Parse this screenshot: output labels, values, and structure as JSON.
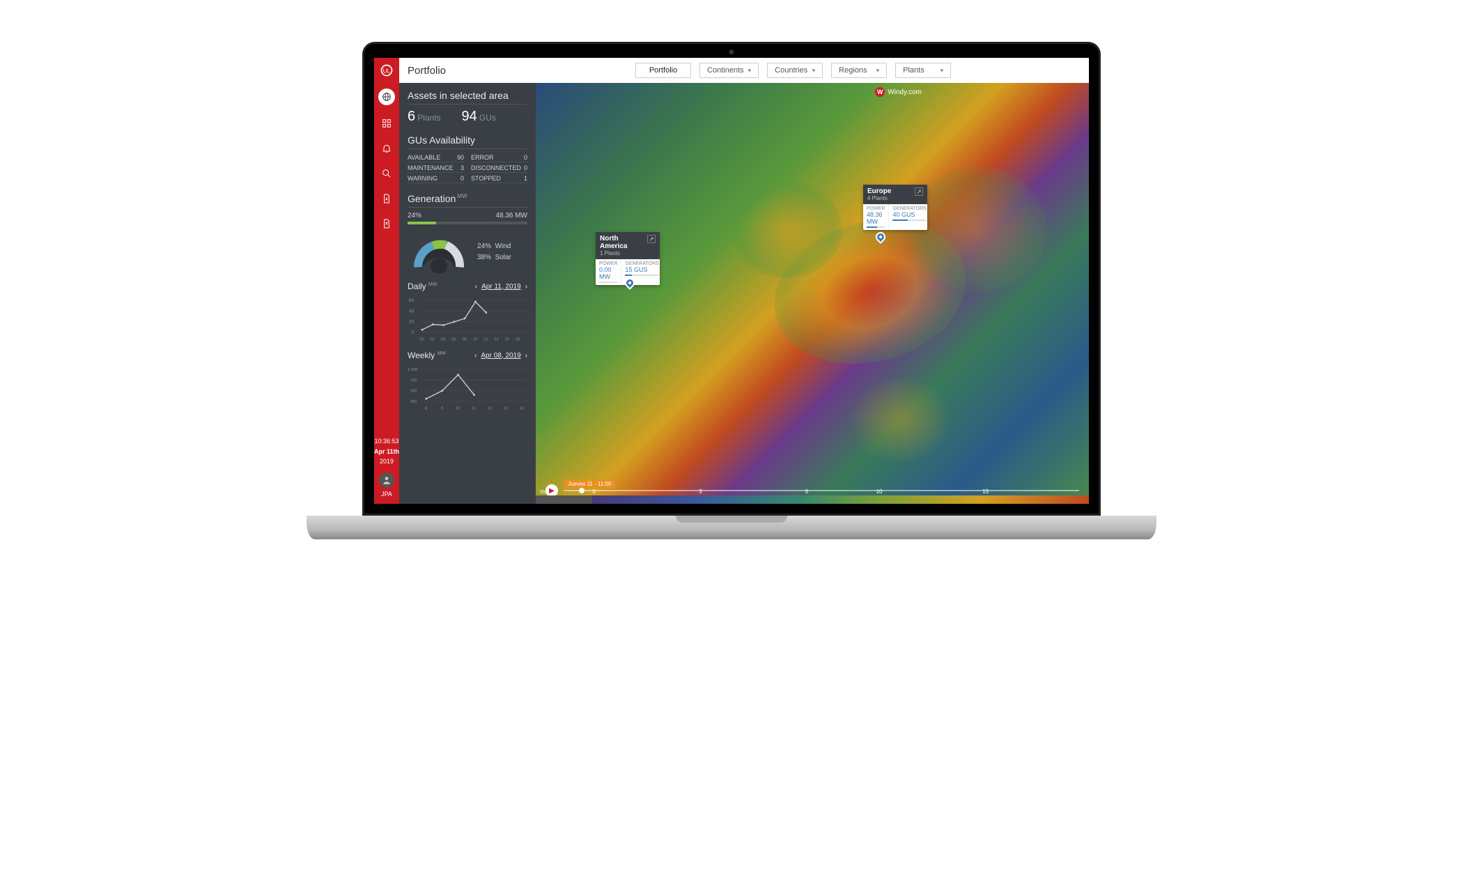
{
  "header": {
    "title": "Portfolio",
    "crumbs": [
      "Portfolio",
      "Continents",
      "Countries",
      "Regions",
      "Plants"
    ]
  },
  "rail": {
    "items": [
      "logo",
      "globe",
      "grid",
      "bell",
      "search",
      "doc-down",
      "doc-up"
    ],
    "time": "10:36:53",
    "date_line1": "Apr 11th",
    "date_line2": "2019",
    "user": "JPA"
  },
  "panel": {
    "assets_title": "Assets in selected area",
    "plants_count": "6",
    "plants_label": "Plants",
    "gus_count": "94",
    "gus_label": "GUs",
    "avail_title": "GUs Availability",
    "avail": [
      {
        "label": "AVAILABLE",
        "value": "90"
      },
      {
        "label": "ERROR",
        "value": "0"
      },
      {
        "label": "MAINTENANCE",
        "value": "3"
      },
      {
        "label": "DISCONNECTED",
        "value": "0"
      },
      {
        "label": "WARNING",
        "value": "0"
      },
      {
        "label": "STOPPED",
        "value": "1"
      }
    ],
    "gen_title": "Generation",
    "gen_unit": "MW",
    "gen_pct": "24%",
    "gen_total": "48.36 MW",
    "gauge_legend": [
      {
        "pct": "24%",
        "label": "Wind"
      },
      {
        "pct": "38%",
        "label": "Solar"
      }
    ],
    "daily": {
      "title": "Daily",
      "unit": "MW",
      "date": "Apr 11, 2019"
    },
    "weekly": {
      "title": "Weekly",
      "unit": "MW",
      "date": "Apr 08, 2019"
    }
  },
  "map": {
    "windy_label": "Windy.com",
    "callouts": {
      "na": {
        "name": "North America",
        "sub": "1 Plants",
        "power_lbl": "POWER",
        "power_val": "0.00 MW",
        "gen_lbl": "GENERATORS",
        "gen_val": "15 GUS"
      },
      "eu": {
        "name": "Europe",
        "sub": "4 Plants",
        "power_lbl": "POWER",
        "power_val": "48.36 MW",
        "gen_lbl": "GENERATORS",
        "gen_val": "40 GUS"
      }
    },
    "timeline_label": "Jueves 11 - 11:00",
    "legend_unit": "m/s",
    "legend_ticks": [
      "0",
      "3",
      "5",
      "10",
      "15"
    ]
  },
  "chart_data": [
    {
      "type": "line",
      "title": "Daily",
      "ylabel": "MW",
      "x": [
        0,
        2,
        4,
        6,
        8,
        10,
        12,
        14,
        16,
        18
      ],
      "y_ticks": [
        0,
        20,
        40,
        60
      ],
      "series": [
        {
          "name": "generation",
          "values": [
            5,
            16,
            14,
            22,
            28,
            60,
            38,
            null,
            null,
            null
          ]
        }
      ],
      "ylim": [
        0,
        60
      ]
    },
    {
      "type": "line",
      "title": "Weekly",
      "ylabel": "MW",
      "x": [
        8,
        9,
        10,
        11,
        12,
        13,
        14
      ],
      "y_ticks": [
        250,
        500,
        750,
        1000
      ],
      "series": [
        {
          "name": "generation",
          "values": [
            300,
            520,
            830,
            420,
            null,
            null,
            null
          ]
        }
      ],
      "ylim": [
        0,
        1000
      ]
    }
  ]
}
